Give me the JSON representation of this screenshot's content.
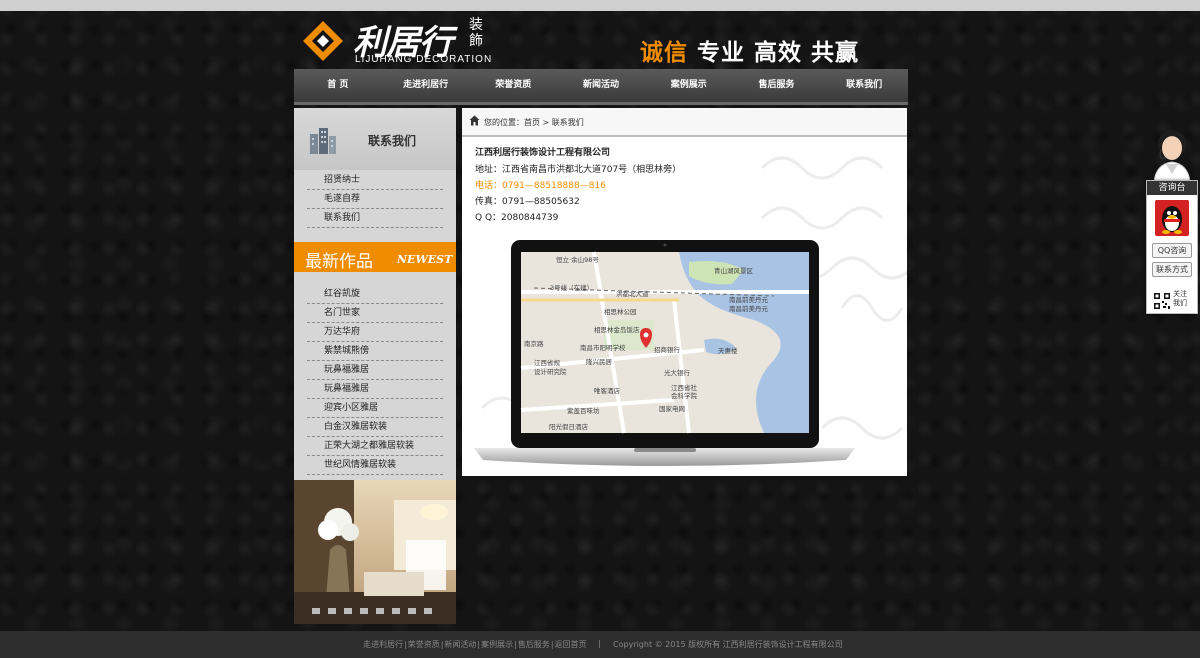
{
  "brand": {
    "logo_cn": "利居行",
    "logo_cn_sub": "装飾",
    "logo_en": "LIJUHANG DECORATION",
    "slogan": [
      "诚信",
      "专业",
      "高效",
      "共赢"
    ],
    "accent_color": "#f08c00"
  },
  "nav": {
    "items": [
      "首 页",
      "走进利居行",
      "荣誉资质",
      "新闻活动",
      "案例展示",
      "售后服务",
      "联系我们"
    ]
  },
  "sidebar": {
    "title": "联系我们",
    "items": [
      "招贤纳士",
      "毛遂自荐",
      "联系我们"
    ],
    "new_banner_cn": "最新作品",
    "new_banner_en": "NEWEST",
    "works": [
      "红谷凯旋",
      "名门世家",
      "万达华府",
      "紫禁城熊傍",
      "玩鼻福雅居",
      "玩鼻福雅居",
      "迎宾小区雅居",
      "白金汉雅居软装",
      "正荣大湖之都雅居软装",
      "世纪风情雅居软装"
    ]
  },
  "breadcrumb": {
    "label": "您的位置：",
    "home": "首页",
    "sep": ">",
    "current": "联系我们"
  },
  "contact": {
    "company": "江西利居行装饰设计工程有限公司",
    "address": "地址：江西省南昌市洪都北大道707号（相思林旁）",
    "phone": "电话：0791—88518888—816",
    "fax": "传真：0791—88505632",
    "qq": "Q Q：2080844739"
  },
  "map": {
    "labels": [
      "恒立·余山98号",
      "青山湖风景区",
      "3号线（在建）",
      "洪都北大道",
      "南昌前美丹元",
      "相思林公园",
      "相思林金岛饭店",
      "南京路",
      "南昌市阳明学校",
      "招商银行",
      "南昌前美丹元",
      "江西省规",
      "设计研究院",
      "隆兴民居",
      "天惠楼",
      "光大银行",
      "江西省社",
      "会科学院",
      "唯客酒店",
      "国家电网",
      "紫盖百味坊",
      "阳光假日酒店"
    ]
  },
  "widget": {
    "title": "咨询台",
    "qq_btn": "QQ咨询",
    "contact_btn": "联系方式",
    "follow": "关注我们"
  },
  "footer": {
    "links": [
      "走进利居行",
      "荣誉资质",
      "新闻活动",
      "案例展示",
      "售后服务",
      "返回首页"
    ],
    "sep": "|",
    "copyright": "Copyright © 2015 版权所有 江西利居行装饰设计工程有限公司"
  }
}
